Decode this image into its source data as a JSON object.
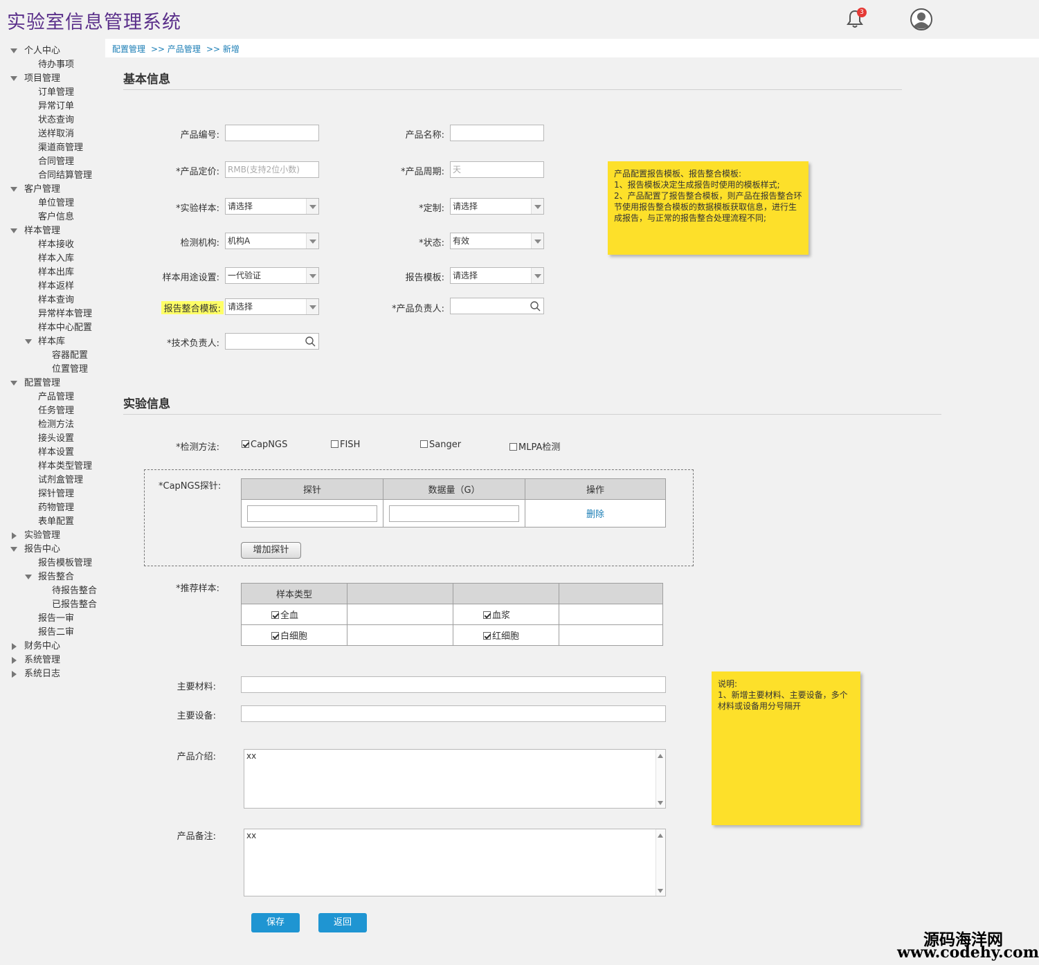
{
  "app": {
    "title": "实验室信息管理系统",
    "notification_count": "3"
  },
  "colors": {
    "accent": "#1f95d2",
    "title": "#5a2f8a",
    "note": "#fde02a",
    "highlight": "#ffff66"
  },
  "sidebar": {
    "items": [
      {
        "label": "个人中心",
        "level": 0,
        "caret": "down"
      },
      {
        "label": "待办事项",
        "level": 1
      },
      {
        "label": "项目管理",
        "level": 0,
        "caret": "down"
      },
      {
        "label": "订单管理",
        "level": 1
      },
      {
        "label": "异常订单",
        "level": 1
      },
      {
        "label": "状态查询",
        "level": 1
      },
      {
        "label": "送样取消",
        "level": 1
      },
      {
        "label": "渠道商管理",
        "level": 1
      },
      {
        "label": "合同管理",
        "level": 1
      },
      {
        "label": "合同结算管理",
        "level": 1
      },
      {
        "label": "客户管理",
        "level": 0,
        "caret": "down"
      },
      {
        "label": "单位管理",
        "level": 1
      },
      {
        "label": "客户信息",
        "level": 1
      },
      {
        "label": "样本管理",
        "level": 0,
        "caret": "down"
      },
      {
        "label": "样本接收",
        "level": 1
      },
      {
        "label": "样本入库",
        "level": 1
      },
      {
        "label": "样本出库",
        "level": 1
      },
      {
        "label": "样本返样",
        "level": 1
      },
      {
        "label": "样本查询",
        "level": 1
      },
      {
        "label": "异常样本管理",
        "level": 1
      },
      {
        "label": "样本中心配置",
        "level": 1
      },
      {
        "label": "样本库",
        "level": 1,
        "caret": "down"
      },
      {
        "label": "容器配置",
        "level": 2
      },
      {
        "label": "位置管理",
        "level": 2
      },
      {
        "label": "配置管理",
        "level": 0,
        "caret": "down"
      },
      {
        "label": "产品管理",
        "level": 1
      },
      {
        "label": "任务管理",
        "level": 1
      },
      {
        "label": "检测方法",
        "level": 1
      },
      {
        "label": "接头设置",
        "level": 1
      },
      {
        "label": "样本设置",
        "level": 1
      },
      {
        "label": "样本类型管理",
        "level": 1
      },
      {
        "label": "试剂盒管理",
        "level": 1
      },
      {
        "label": "探针管理",
        "level": 1
      },
      {
        "label": "药物管理",
        "level": 1
      },
      {
        "label": "表单配置",
        "level": 1
      },
      {
        "label": "实验管理",
        "level": 0,
        "caret": "right"
      },
      {
        "label": "报告中心",
        "level": 0,
        "caret": "down"
      },
      {
        "label": "报告模板管理",
        "level": 1
      },
      {
        "label": "报告整合",
        "level": 1,
        "caret": "down"
      },
      {
        "label": "待报告整合",
        "level": 2
      },
      {
        "label": "已报告整合",
        "level": 2
      },
      {
        "label": "报告一审",
        "level": 1
      },
      {
        "label": "报告二审",
        "level": 1
      },
      {
        "label": "财务中心",
        "level": 0,
        "caret": "right"
      },
      {
        "label": "系统管理",
        "level": 0,
        "caret": "right"
      },
      {
        "label": "系统日志",
        "level": 0,
        "caret": "right"
      }
    ]
  },
  "breadcrumb": {
    "c1": "配置管理",
    "c2": ">> 产品管理",
    "c3": ">> 新增"
  },
  "basic": {
    "title": "基本信息",
    "product_code_label": "产品编号:",
    "product_name_label": "产品名称:",
    "price_label": "*产品定价:",
    "price_placeholder": "RMB(支持2位小数)",
    "cycle_label": "*产品周期:",
    "cycle_placeholder": "天",
    "sample_label": "*实验样本:",
    "sample_value": "请选择",
    "custom_label": "*定制:",
    "custom_value": "请选择",
    "org_label": "检测机构:",
    "org_value": "机构A",
    "status_label": "*状态:",
    "status_value": "有效",
    "usage_label": "样本用途设置:",
    "usage_value": "一代验证",
    "report_tpl_label": "报告模板:",
    "report_tpl_value": "请选择",
    "merge_tpl_label": "报告整合模板:",
    "merge_tpl_value": "请选择",
    "owner_label": "*产品负责人:",
    "tech_label": "*技术负责人:"
  },
  "note1": {
    "line1": "产品配置报告模板、报告整合模板:",
    "line2": "1、报告模板决定生成报告时使用的模板样式;",
    "line3": "2、产品配置了报告整合模板，则产品在报告整合环节使用报告整合模板的数据模板获取信息，进行生成报告，与正常的报告整合处理流程不同;"
  },
  "exp": {
    "title": "实验信息",
    "method_label": "*检测方法:",
    "methods": [
      {
        "label": "CapNGS",
        "checked": true
      },
      {
        "label": "FISH",
        "checked": false
      },
      {
        "label": "Sanger",
        "checked": false
      },
      {
        "label": "MLPA检测",
        "checked": false
      }
    ],
    "probe_label": "*CapNGS探针:",
    "probe_headers": [
      "探针",
      "数据量（G）",
      "操作"
    ],
    "probe_delete": "删除",
    "add_probe": "增加探针",
    "rec_label": "*推荐样本:",
    "rec_header": "样本类型",
    "rec_samples": [
      "全血",
      "血浆",
      "白细胞",
      "红细胞"
    ],
    "material_label": "主要材料:",
    "device_label": "主要设备:",
    "intro_label": "产品介绍:",
    "intro_value": "xx",
    "remark_label": "产品备注:",
    "remark_value": "xx",
    "save": "保存",
    "back": "返回"
  },
  "note2": {
    "line1": "说明:",
    "line2": "1、新增主要材料、主要设备，多个材料或设备用分号隔开"
  },
  "watermark": {
    "cn": "源码海洋网",
    "url": "www.codehy.com"
  }
}
